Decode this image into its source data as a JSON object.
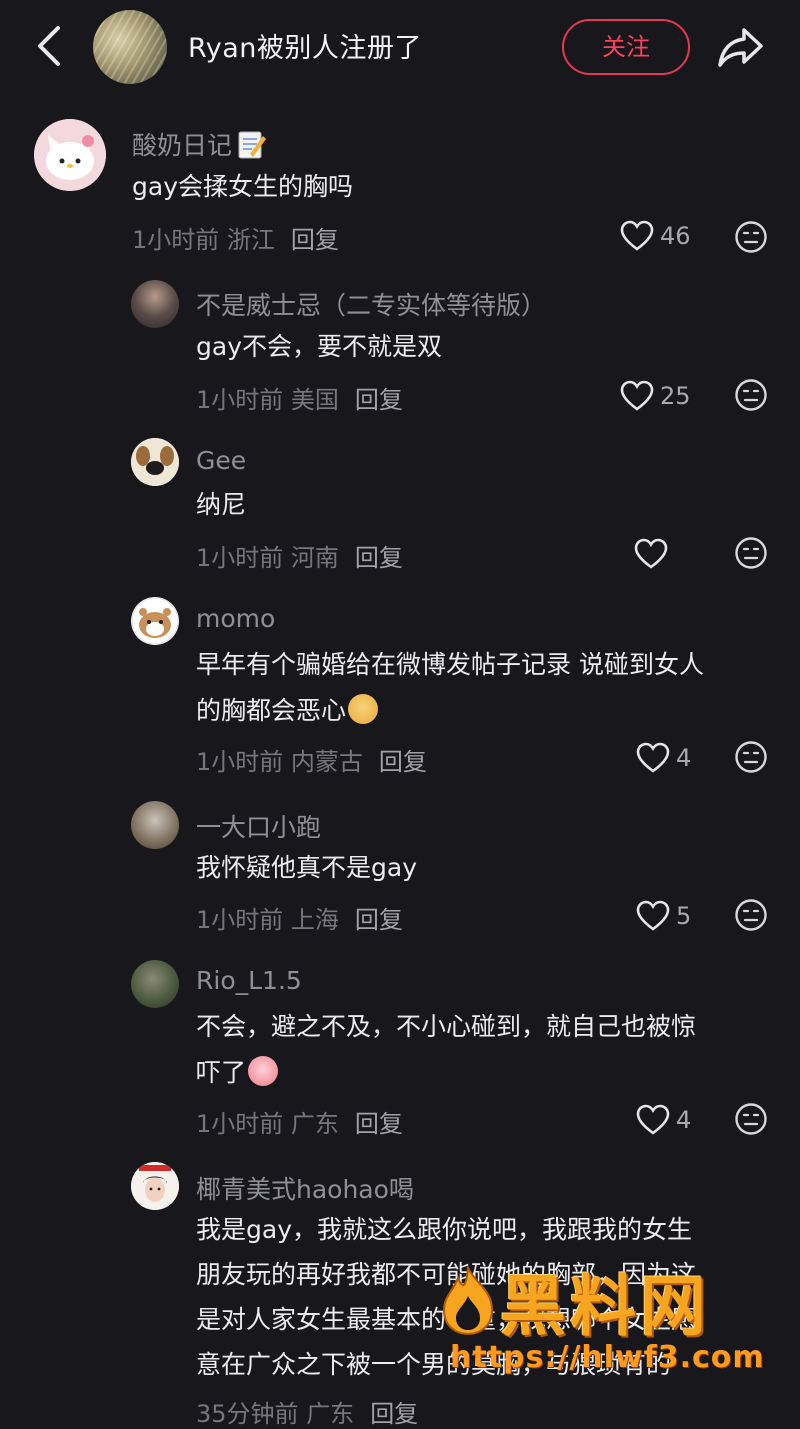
{
  "header": {
    "title": "Ryan被别人注册了",
    "follow_label": "关注"
  },
  "comments": [
    {
      "user": "酸奶日记",
      "text": [
        "gay会揉女生的胸吗"
      ],
      "time": "1小时前",
      "location": "浙江",
      "reply": "回复",
      "likes": "46",
      "avatar_icon": "hello-kitty-avatar",
      "name_icon": "memo-emoji"
    },
    {
      "user": "不是威士忌（二专实体等待版）",
      "text": [
        "gay不会，要不就是双"
      ],
      "time": "1小时前",
      "location": "美国",
      "reply": "回复",
      "likes": "25"
    },
    {
      "user": "Gee",
      "text": [
        "纳尼"
      ],
      "time": "1小时前",
      "location": "河南",
      "reply": "回复",
      "likes": ""
    },
    {
      "user": "momo",
      "text": [
        "早年有个骗婚给在微博发帖子记录 说碰到女人",
        "的胸都会恶心"
      ],
      "time": "1小时前",
      "location": "内蒙古",
      "reply": "回复",
      "likes": "4",
      "emoji": "dog-face-emoji"
    },
    {
      "user": "一大口小跑",
      "text": [
        "我怀疑他真不是gay"
      ],
      "time": "1小时前",
      "location": "上海",
      "reply": "回复",
      "likes": "5"
    },
    {
      "user": "Rio_L1.5",
      "text": [
        "不会，避之不及，不小心碰到，就自己也被惊",
        "吓了"
      ],
      "time": "1小时前",
      "location": "广东",
      "reply": "回复",
      "likes": "4",
      "emoji": "crying-face-emoji"
    },
    {
      "user": "椰青美式haohao喝",
      "text": [
        "我是gay，我就这么跟你说吧，我跟我的女生",
        "朋友玩的再好我都不可能碰她的胸部，因为这",
        "是对人家女生最基本的尊重，我想哪个女生愿",
        "意在广众之下被一个男的莫胸，与猥琐有的"
      ],
      "time": "35分钟前",
      "location": "广东",
      "reply": "回复",
      "likes": ""
    }
  ],
  "watermark": {
    "logo": "黑料网",
    "url": "https://hlwf3.com"
  },
  "colors": {
    "background": "#18171c",
    "follow_accent": "#ff3f5b",
    "watermark": "#f7a51f"
  }
}
